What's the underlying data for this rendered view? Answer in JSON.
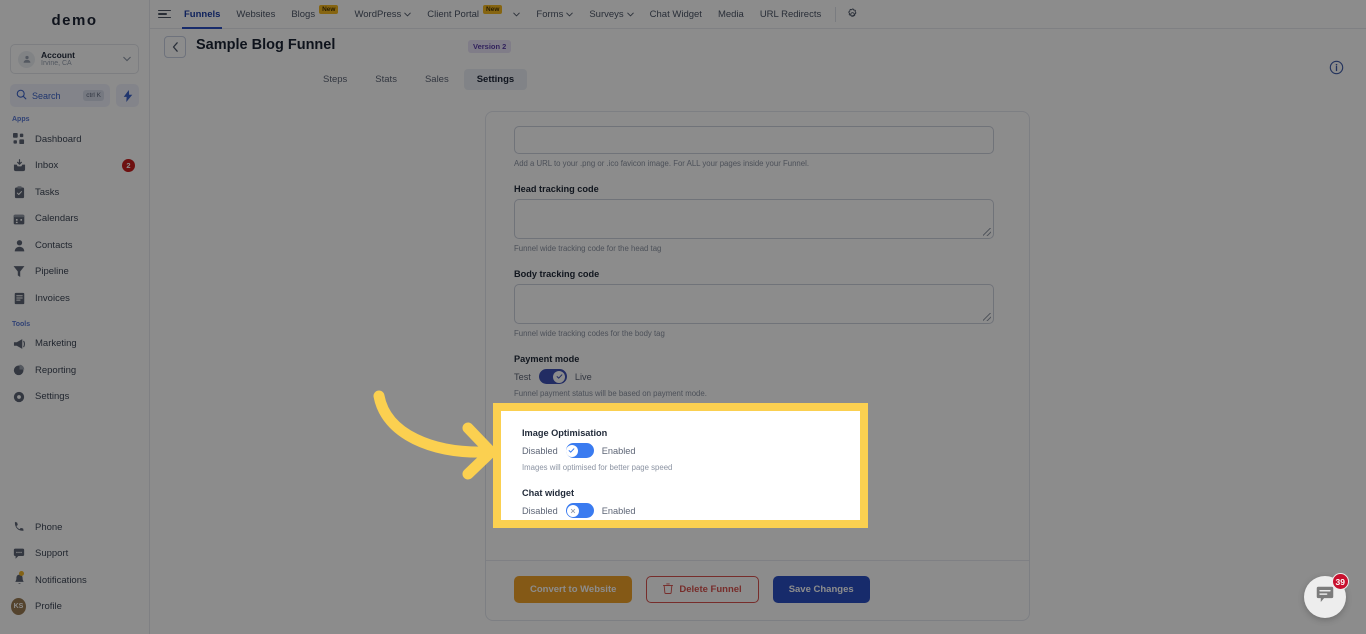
{
  "brand": {
    "name": "demo"
  },
  "account": {
    "name": "Account",
    "location": "Irvine, CA",
    "icon": "user-circle-icon",
    "chevron": "chevron-down-icon"
  },
  "search": {
    "label": "Search",
    "shortcut": "ctrl K",
    "icon": "search-icon",
    "bolt_icon": "bolt-icon"
  },
  "sidebar": {
    "section_apps": "Apps",
    "section_tools": "Tools",
    "apps": [
      {
        "label": "Dashboard",
        "icon": "dashboard-grid-icon"
      },
      {
        "label": "Inbox",
        "icon": "inbox-icon",
        "badge": "2"
      },
      {
        "label": "Tasks",
        "icon": "clipboard-check-icon"
      },
      {
        "label": "Calendars",
        "icon": "calendar-icon"
      },
      {
        "label": "Contacts",
        "icon": "contact-person-icon"
      },
      {
        "label": "Pipeline",
        "icon": "funnel-filter-icon"
      },
      {
        "label": "Invoices",
        "icon": "invoice-document-icon"
      }
    ],
    "tools": [
      {
        "label": "Marketing",
        "icon": "megaphone-icon"
      },
      {
        "label": "Reporting",
        "icon": "pie-chart-icon"
      },
      {
        "label": "Settings",
        "icon": "gear-icon"
      }
    ],
    "bottom": [
      {
        "label": "Phone",
        "icon": "phone-icon"
      },
      {
        "label": "Support",
        "icon": "support-chat-icon"
      },
      {
        "label": "Notifications",
        "icon": "bell-icon",
        "dot": true
      },
      {
        "label": "Profile",
        "icon": "avatar-icon",
        "initials": "KS"
      }
    ]
  },
  "topnav": {
    "hamburger": "hamburger-menu-icon",
    "items": [
      {
        "label": "Funnels",
        "active": true
      },
      {
        "label": "Websites"
      },
      {
        "label": "Blogs",
        "tag": "New"
      },
      {
        "label": "WordPress",
        "caret": true
      },
      {
        "label": "Client Portal",
        "tag": "New",
        "caret": true
      },
      {
        "label": "Forms",
        "caret": true
      },
      {
        "label": "Surveys",
        "caret": true
      },
      {
        "label": "Chat Widget"
      },
      {
        "label": "Media"
      },
      {
        "label": "URL Redirects"
      }
    ],
    "gear_icon": "gear-icon"
  },
  "header": {
    "back_icon": "chevron-left-icon",
    "title": "Sample Blog Funnel",
    "version_tag": "Version 2",
    "info_icon": "info-circle-icon",
    "tabs": [
      {
        "label": "Steps",
        "active": false
      },
      {
        "label": "Stats",
        "active": false
      },
      {
        "label": "Sales",
        "active": false
      },
      {
        "label": "Settings",
        "active": true
      }
    ]
  },
  "form": {
    "favicon": {
      "value": "",
      "hint": "Add a URL to your .png or .ico favicon image. For ALL your pages inside your Funnel."
    },
    "head_tracking": {
      "label": "Head tracking code",
      "value": "",
      "hint": "Funnel wide tracking code for the head tag"
    },
    "body_tracking": {
      "label": "Body tracking code",
      "value": "",
      "hint": "Funnel wide tracking codes for the body tag"
    },
    "payment_mode": {
      "label": "Payment mode",
      "off_label": "Test",
      "on_label": "Live",
      "state": "on",
      "hint": "Funnel payment status will be based on payment mode."
    },
    "image_optimisation": {
      "label": "Image Optimisation",
      "off_label": "Disabled",
      "on_label": "Enabled",
      "state": "on",
      "knob_mark": "✓",
      "hint": "Images will optimised for better page speed"
    },
    "chat_widget": {
      "label": "Chat widget",
      "off_label": "Disabled",
      "on_label": "Enabled",
      "state": "off",
      "knob_mark": "✕"
    }
  },
  "footer": {
    "convert_label": "Convert to Website",
    "delete_label": "Delete Funnel",
    "delete_icon": "trash-icon",
    "save_label": "Save Changes"
  },
  "chat_launcher": {
    "icon": "chat-bubble-icon",
    "badge": "39"
  },
  "annotation": {
    "arrow": "curved-arrow-right",
    "arrow_color": "#fbd050",
    "highlight_color": "#fbd050"
  }
}
